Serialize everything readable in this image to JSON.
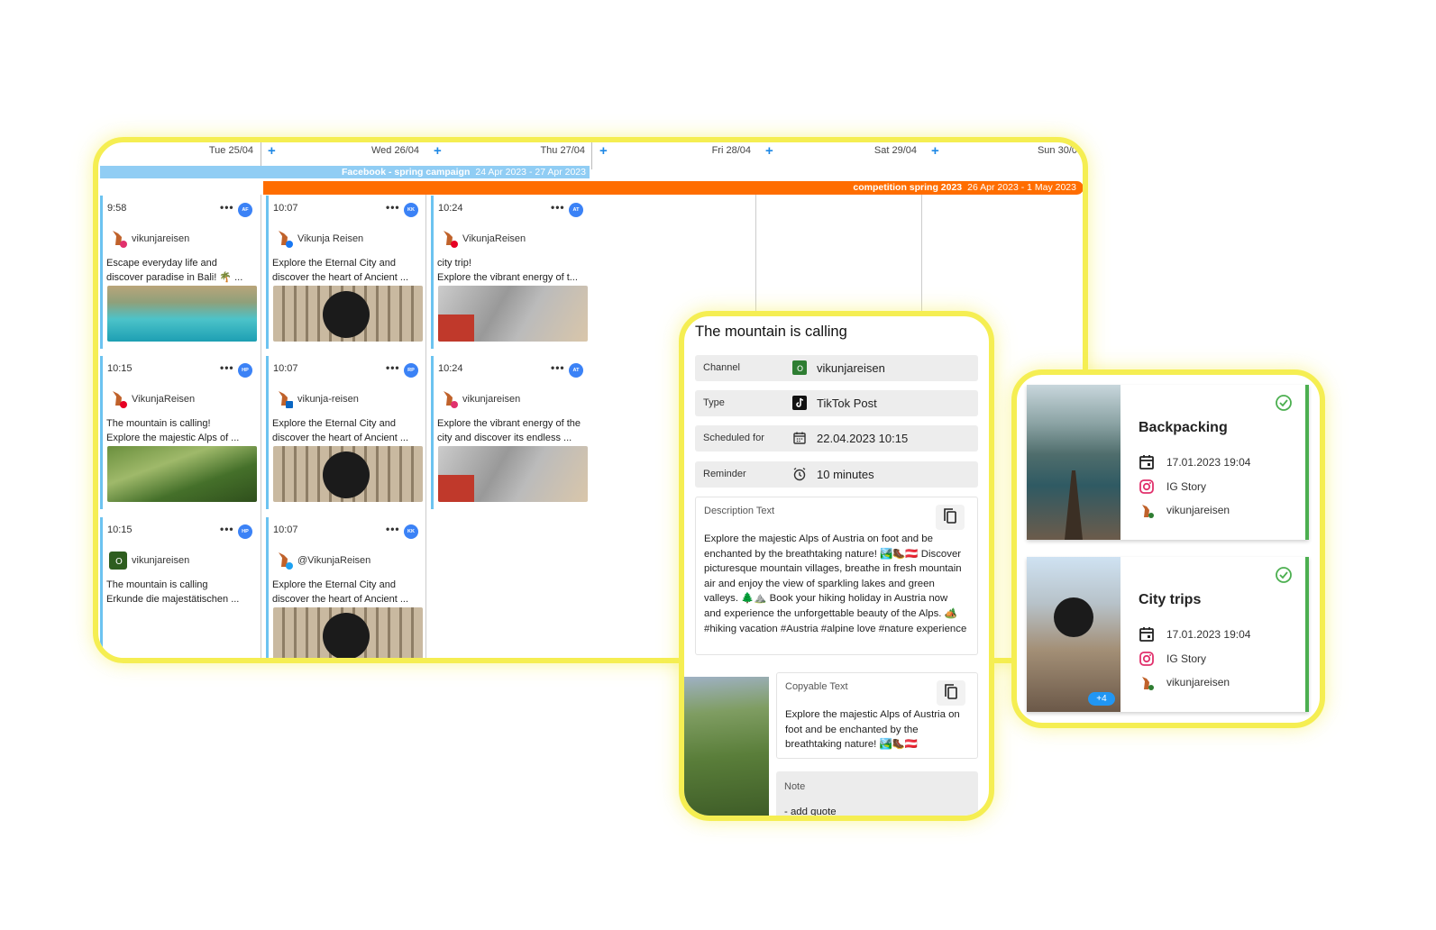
{
  "calendar": {
    "days": [
      "Tue 25/04",
      "Wed 26/04",
      "Thu 27/04",
      "Fri 28/04",
      "Sat 29/04",
      "Sun 30/0"
    ],
    "campaigns": {
      "facebook": {
        "name": "Facebook - spring campaign",
        "range": "24 Apr 2023 - 27 Apr 2023",
        "color": "#90cdf4"
      },
      "competition": {
        "name": "competition spring 2023",
        "range": "26 Apr 2023 - 1 May 2023",
        "color": "#ff6d00"
      }
    },
    "posts": [
      {
        "time": "9:58",
        "avatar": "AF",
        "channel": "vikunjareisen",
        "network": "instagram",
        "line1": "Escape everyday life and",
        "line2": "discover paradise in Bali! 🌴 ..."
      },
      {
        "time": "10:07",
        "avatar": "KK",
        "channel": "Vikunja Reisen",
        "network": "facebook",
        "line1": "Explore the Eternal City and",
        "line2": "discover the heart of Ancient ..."
      },
      {
        "time": "10:24",
        "avatar": "AT",
        "channel": "VikunjaReisen",
        "network": "pinterest",
        "line1": "city trip!",
        "line2": "Explore the vibrant energy of t..."
      },
      {
        "time": "10:15",
        "avatar": "HP",
        "channel": "VikunjaReisen",
        "network": "pinterest",
        "line1": "The mountain is calling!",
        "line2": "Explore the majestic Alps of ..."
      },
      {
        "time": "10:07",
        "avatar": "RP",
        "channel": "vikunja-reisen",
        "network": "linkedin",
        "line1": "Explore the Eternal City and",
        "line2": "discover the heart of Ancient ..."
      },
      {
        "time": "10:24",
        "avatar": "AT",
        "channel": "vikunjareisen",
        "network": "instagram",
        "line1": "Explore the vibrant energy of the",
        "line2": "city and discover its endless ..."
      },
      {
        "time": "10:15",
        "avatar": "HP",
        "channel": "vikunjareisen",
        "network": "other",
        "line1": "The mountain is calling",
        "line2": "Erkunde die majestätischen ..."
      },
      {
        "time": "10:07",
        "avatar": "KK",
        "channel": "@VikunjaReisen",
        "network": "twitter",
        "line1": "Explore the Eternal City and",
        "line2": "discover the heart of Ancient ..."
      }
    ]
  },
  "detail": {
    "title": "The mountain is calling",
    "fields": [
      {
        "label": "Channel",
        "value": "vikunjareisen",
        "icon": "channel-icon"
      },
      {
        "label": "Type",
        "value": "TikTok Post",
        "icon": "tiktok-icon"
      },
      {
        "label": "Scheduled for",
        "value": "22.04.2023 10:15",
        "icon": "calendar-icon"
      },
      {
        "label": "Reminder",
        "value": "10 minutes",
        "icon": "alarm-icon"
      }
    ],
    "description_label": "Description Text",
    "description_text": "Explore the majestic Alps of Austria on foot and be enchanted by the breathtaking nature! 🏞️🥾🇦🇹 Discover picturesque mountain villages, breathe in fresh mountain air and enjoy the view of sparkling lakes and green valleys. 🌲⛰️ Book your hiking holiday in Austria now and experience the unforgettable beauty of the Alps. 🏕️ #hiking vacation #Austria #alpine love #nature experience",
    "copyable_label": "Copyable Text",
    "copyable_text": "Explore the majestic Alps of Austria on foot and be enchanted by the breathtaking nature! 🏞️🥾🇦🇹",
    "note_label": "Note",
    "note_text": "- add quote"
  },
  "board": {
    "cards": [
      {
        "title": "Backpacking",
        "date": "17.01.2023 19:04",
        "type": "IG Story",
        "channel": "vikunjareisen"
      },
      {
        "title": "City trips",
        "date": "17.01.2023 19:04",
        "type": "IG Story",
        "channel": "vikunjareisen",
        "more": "+4"
      }
    ]
  },
  "colors": {
    "highlight": "#f5ee52",
    "accent_blue": "#1e88e5",
    "status_green": "#4caf50"
  }
}
